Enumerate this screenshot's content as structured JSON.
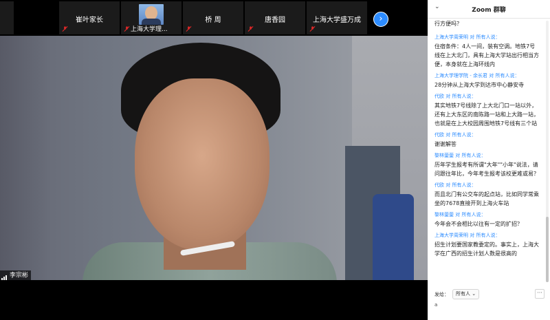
{
  "thumbnails": [
    {
      "name": "崔叶家长"
    },
    {
      "name": "上海大学理..."
    },
    {
      "name": "桥 周"
    },
    {
      "name": "唐香园"
    },
    {
      "name": "上海大学盛万成"
    }
  ],
  "main_video": {
    "participant_name": "李宗彬"
  },
  "chat": {
    "title": "Zoom 群聊",
    "top_text": "行方便吗？",
    "messages": [
      {
        "sender": "上海大学周荣明",
        "to": "对 所有人说：",
        "text": "住宿条件：4人一间，装有空调。地铁7号线在上大北门，具有上海大学站出行相当方便，本身就在上海环线内"
      },
      {
        "sender": "上海大学理学院 - 余长君",
        "to": "对 所有人说：",
        "text": "28分钟从上海大学到达市中心静安寺"
      },
      {
        "sender": "代欧",
        "to": "对 所有人说：",
        "text": "其实地铁7号线除了上大北门口一站以外，还有上大东区的南陈路一站和上大路一站，也就是在上大校园周围地铁7号线有三个站"
      },
      {
        "sender": "代欧",
        "to": "对 所有人说：",
        "text": "谢谢解答"
      },
      {
        "sender": "黎林蓥蓥",
        "to": "对 所有人说：",
        "text": "历年学生报考有所谓\"大年\"\"小年\"说法，请问跟往年比，今年考生报考该校更难或易？"
      },
      {
        "sender": "代欧",
        "to": "对 所有人说：",
        "text": "而且北门有公交车的起点站，比如同学常乘坐的7678直接开到上海火车站"
      },
      {
        "sender": "黎林蓥蓥",
        "to": "对 所有人说：",
        "text": "今年会不会相比以往有一定的扩招？"
      },
      {
        "sender": "上海大学周荣明",
        "to": "对 所有人说：",
        "text": "招生计划要国家教委定的。事实上，上海大学在广西的招生计划人数是很高的"
      }
    ],
    "send_label": "发给：",
    "send_target": "所有人",
    "more_label": "···",
    "input_value": "a"
  },
  "colors": {
    "accent": "#2d8cff",
    "mic_muted": "#e02828"
  }
}
